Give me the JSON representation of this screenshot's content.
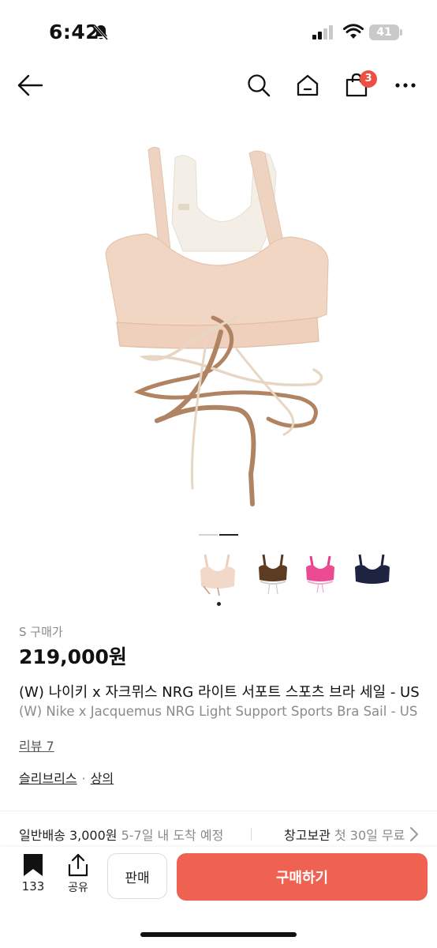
{
  "status_bar": {
    "time": "6:42",
    "battery": "41"
  },
  "nav": {
    "cart_count": "3"
  },
  "product": {
    "size_label": "S 구매가",
    "price": "219,000원",
    "title_ko": "(W) 나이키 x 자크뮈스 NRG 라이트 서포트 스포츠 브라 세일 - US",
    "title_en": "(W) Nike x Jacquemus NRG Light Support Sports Bra Sail - US",
    "reviews": "리뷰 7",
    "category_brand": "슬리브리스",
    "category_sep": "·",
    "category_type": "상의"
  },
  "shipping": {
    "label": "일반배송 3,000원",
    "eta": "5-7일 내 도착 예정",
    "storage_label": "창고보관",
    "storage_detail": "첫 30일 무료"
  },
  "bottom": {
    "bookmark_count": "133",
    "share_label": "공유",
    "sell_label": "판매",
    "buy_label": "구매하기"
  },
  "thumbnails": [
    "sail",
    "brown",
    "pink",
    "navy"
  ],
  "colors": {
    "accent": "#ef6252",
    "badge": "#ee4f44"
  },
  "icons": [
    "bell-off-icon",
    "signal-icon",
    "wifi-icon",
    "battery-icon",
    "back-arrow-icon",
    "search-icon",
    "home-icon",
    "cart-icon",
    "more-icon",
    "bookmark-icon",
    "share-icon",
    "chevron-right-icon"
  ]
}
